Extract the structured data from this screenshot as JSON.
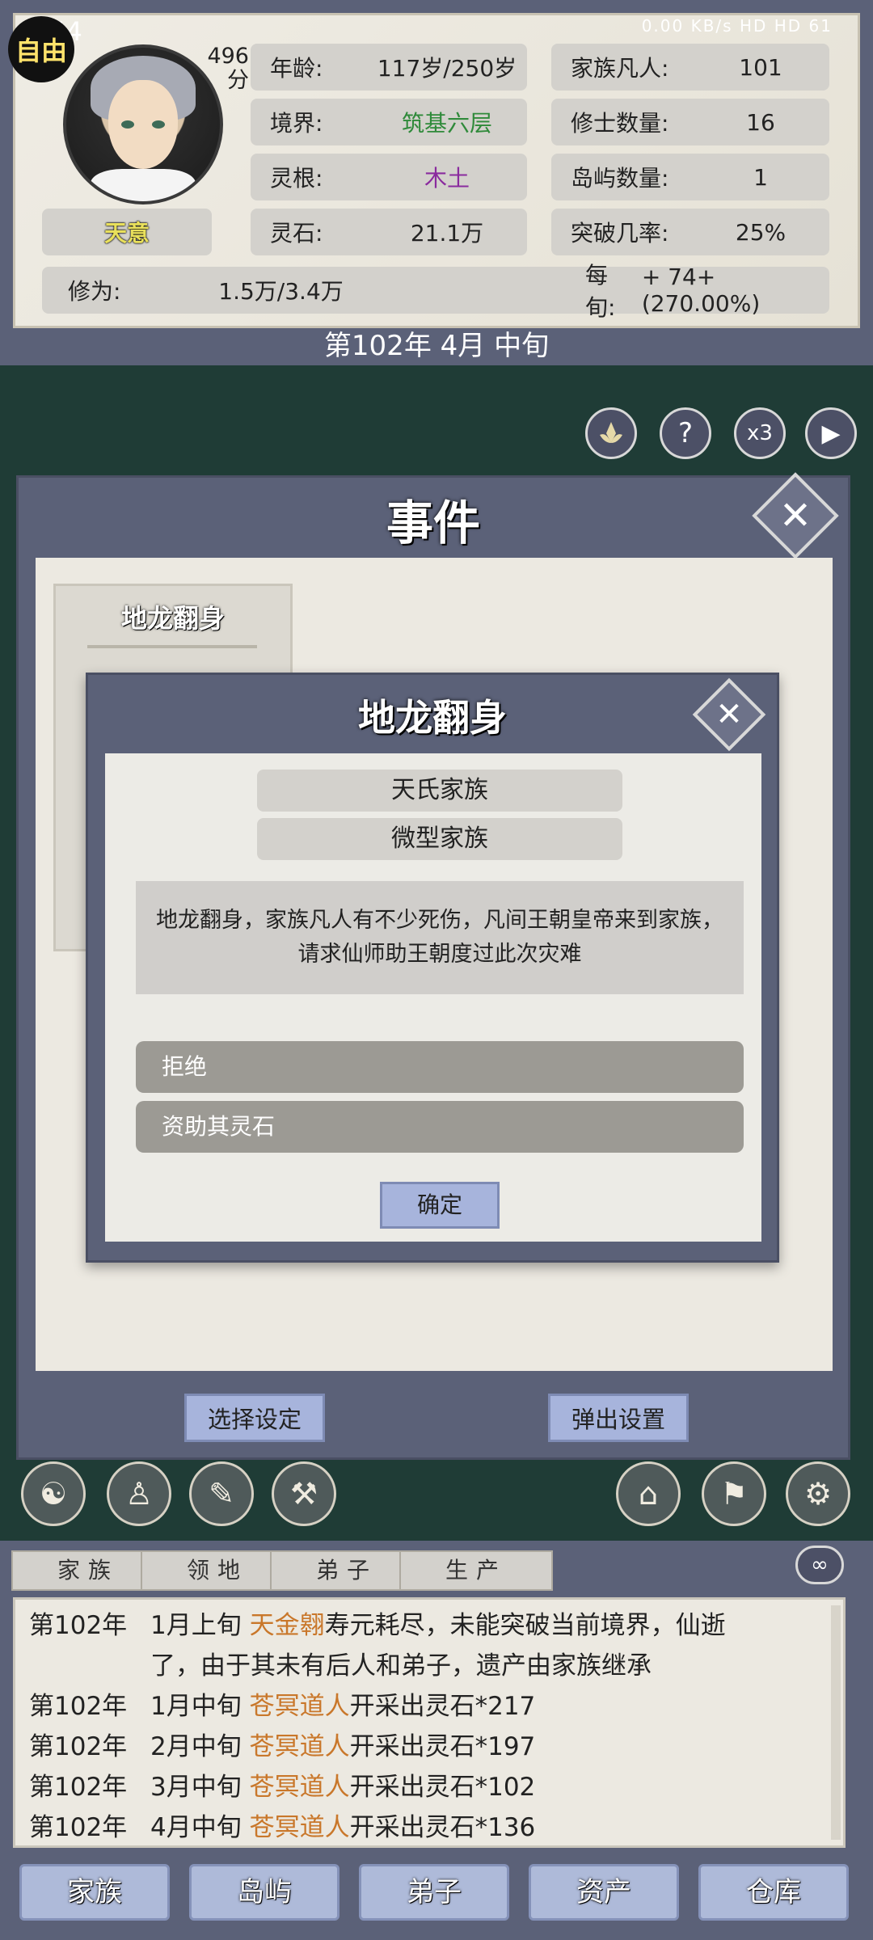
{
  "status": {
    "time": "9:54",
    "indicators": "0.00 KB/s  HD  HD  61"
  },
  "header": {
    "auto_badge": "自由",
    "score_value": "496",
    "score_unit": "分",
    "title_badge": "天意",
    "stats_left": [
      {
        "key": "年龄:",
        "value": "117岁/250岁",
        "color": "#222222"
      },
      {
        "key": "境界:",
        "value": "筑基六层",
        "color": "#2f8a3a"
      },
      {
        "key": "灵根:",
        "value": "木土",
        "color": "#8a2b9e"
      },
      {
        "key": "灵石:",
        "value": "21.1万",
        "color": "#222222"
      }
    ],
    "stats_right": [
      {
        "key": "家族凡人:",
        "value": "101"
      },
      {
        "key": "修士数量:",
        "value": "16"
      },
      {
        "key": "岛屿数量:",
        "value": "1"
      },
      {
        "key": "突破几率:",
        "value": "25%"
      }
    ],
    "cultivation_label": "修为:",
    "cultivation_value": "1.5万/3.4万",
    "per_period_label": "每旬:",
    "per_period_value": "+ 74+(270.00%)",
    "date": "第102年 4月 中旬"
  },
  "controls": {
    "help": "?",
    "speed": "x3",
    "play": "▶"
  },
  "event_window": {
    "title": "事件",
    "close": "✕",
    "card_title": "地龙翻身",
    "select_settings": "选择设定",
    "popup_settings": "弹出设置"
  },
  "dialog": {
    "title": "地龙翻身",
    "close": "✕",
    "tag1": "天氏家族",
    "tag2": "微型家族",
    "description": "地龙翻身，家族凡人有不少死伤，凡间王朝皇帝来到家族，请求仙师助王朝度过此次灾难",
    "option1": "拒绝",
    "option2": "资助其灵石",
    "confirm": "确定"
  },
  "log_tabs": [
    "家族",
    "领地",
    "弟子",
    "生产"
  ],
  "log": [
    {
      "year": "第102年",
      "time": "1月上旬",
      "name": "天金翱",
      "text": "寿元耗尽，未能突破当前境界，仙逝"
    },
    {
      "year": "",
      "time": "",
      "name": "",
      "text": "了，由于其未有后人和弟子，遗产由家族继承"
    },
    {
      "year": "第102年",
      "time": "1月中旬",
      "name": "苍冥道人",
      "text": "开采出灵石*217"
    },
    {
      "year": "第102年",
      "time": "2月中旬",
      "name": "苍冥道人",
      "text": "开采出灵石*197"
    },
    {
      "year": "第102年",
      "time": "3月中旬",
      "name": "苍冥道人",
      "text": "开采出灵石*102"
    },
    {
      "year": "第102年",
      "time": "4月中旬",
      "name": "苍冥道人",
      "text": "开采出灵石*136"
    }
  ],
  "bottom_nav": [
    "家族",
    "岛屿",
    "弟子",
    "资产",
    "仓库"
  ]
}
